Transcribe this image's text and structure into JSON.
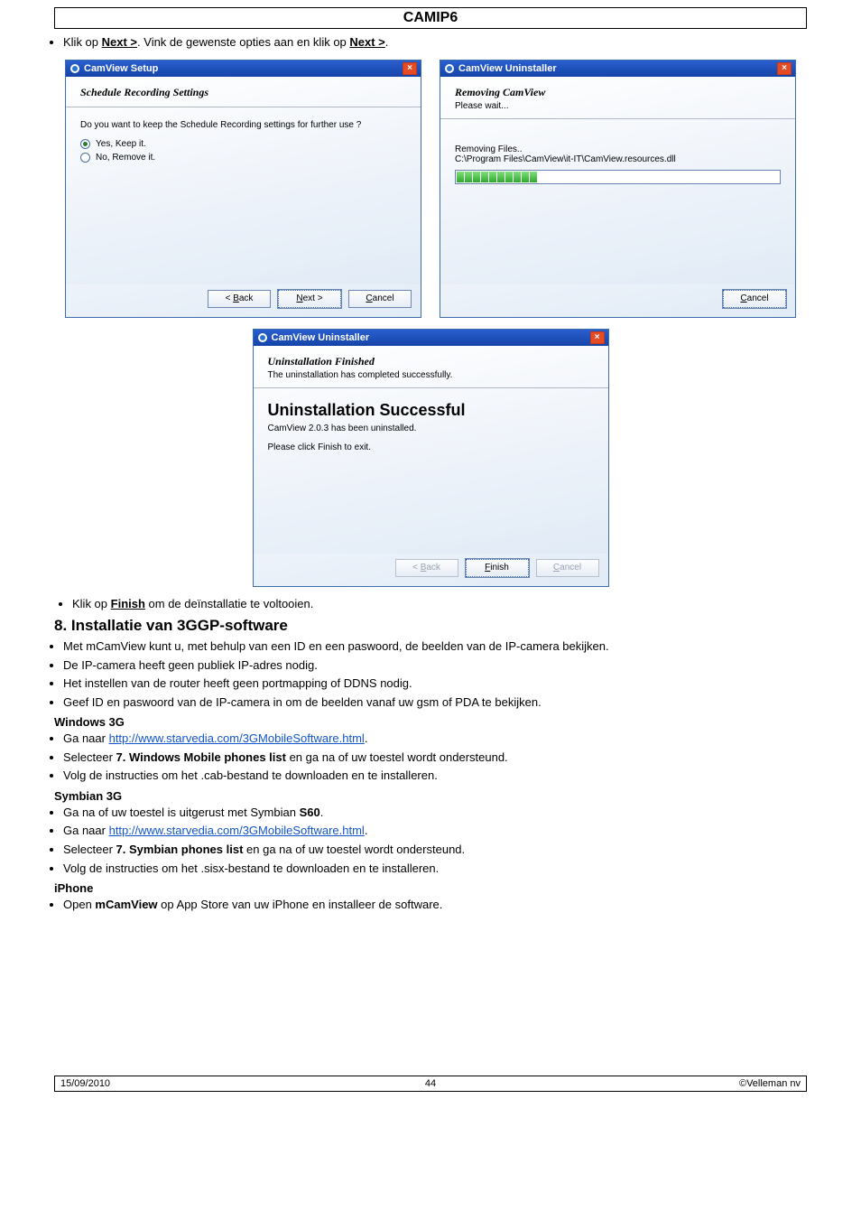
{
  "page": {
    "title": "CAMIP6",
    "instruction_next": "Klik op ",
    "instruction_next_bold": "Next >",
    "instruction_next_tail": ". Vink de gewenste opties aan en klik op ",
    "instruction_next_bold2": "Next >",
    "instruction_next_tail2": ".",
    "instruction_finish_pre": "Klik op ",
    "instruction_finish_bold": "Finish",
    "instruction_finish_post": " om de deïnstallatie te voltooien."
  },
  "win_setup": {
    "title": "CamView Setup",
    "heading": "Schedule Recording Settings",
    "question": "Do you want to keep the Schedule Recording settings for further use ?",
    "opt_yes": "Yes, Keep it.",
    "opt_no": "No, Remove it.",
    "back": "< Back",
    "next": "Next >",
    "cancel": "Cancel"
  },
  "win_remove": {
    "title": "CamView Uninstaller",
    "heading": "Removing CamView",
    "sub": "Please wait...",
    "status": "Removing Files..",
    "path": "C:\\Program Files\\CamView\\it-IT\\CamView.resources.dll",
    "cancel": "Cancel"
  },
  "win_done": {
    "title": "CamView Uninstaller",
    "heading": "Uninstallation Finished",
    "sub": "The uninstallation has completed successfully.",
    "big": "Uninstallation Successful",
    "line2": "CamView 2.0.3 has been uninstalled.",
    "line3": "Please click Finish to exit.",
    "back": "< Back",
    "finish": "Finish",
    "cancel": "Cancel"
  },
  "section8": {
    "heading": "8. Installatie van 3GGP-software",
    "items": [
      "Met mCamView kunt u, met behulp van een ID en een paswoord, de beelden van de IP-camera bekijken.",
      "De IP-camera heeft geen publiek IP-adres nodig.",
      "Het instellen van de router heeft geen portmapping of DDNS nodig.",
      "Geef ID en paswoord van de IP-camera in om de beelden vanaf uw gsm of PDA te bekijken."
    ]
  },
  "windows3g": {
    "heading": "Windows 3G",
    "pre1": "Ga naar ",
    "link1": "http://www.starvedia.com/3GMobileSoftware.html",
    "select_pre": "Selecteer ",
    "select_bold": "7. Windows Mobile phones list",
    "select_post": " en ga na of uw toestel wordt ondersteund.",
    "item3": "Volg de instructies om het .cab-bestand te downloaden en te installeren."
  },
  "symbian3g": {
    "heading": "Symbian 3G",
    "pre1": "Ga na of uw toestel is uitgerust met Symbian ",
    "bold1": "S60",
    "post1": ".",
    "pre2": "Ga naar ",
    "link2": "http://www.starvedia.com/3GMobileSoftware.html",
    "select_pre": "Selecteer ",
    "select_bold": "7. Symbian phones list",
    "select_post": " en ga na of uw toestel wordt ondersteund.",
    "item4": "Volg de instructies om het .sisx-bestand te downloaden en te installeren."
  },
  "iphone": {
    "heading": "iPhone",
    "pre": "Open ",
    "bold": "mCamView",
    "post": " op App Store van uw iPhone en installeer de software."
  },
  "footer": {
    "left": "15/09/2010",
    "center": "44",
    "right": "©Velleman nv"
  }
}
